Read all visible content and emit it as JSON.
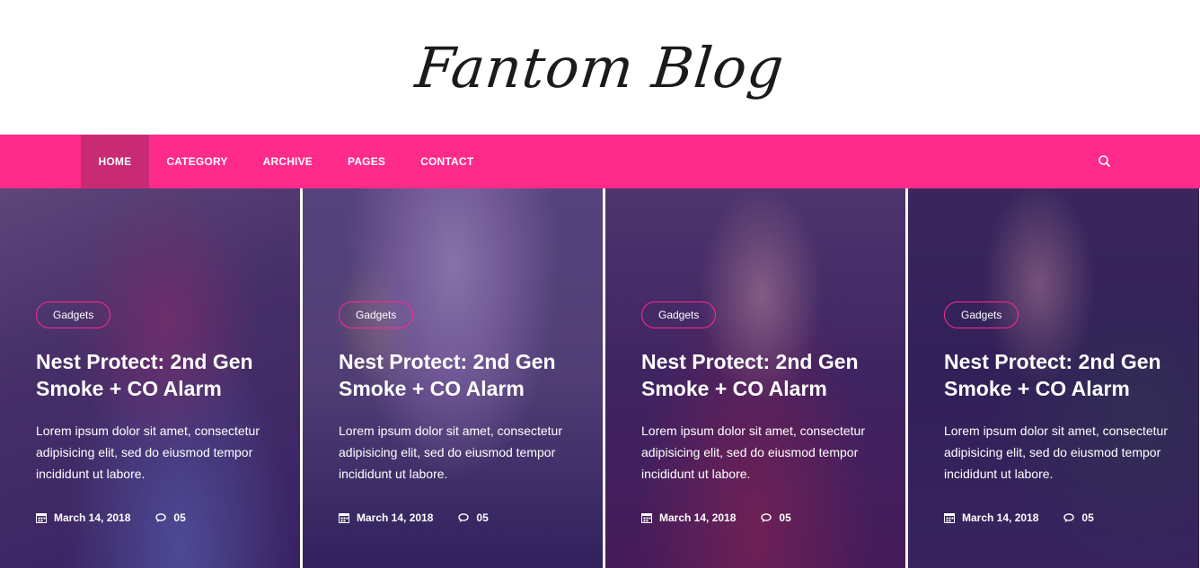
{
  "site": {
    "logo_text": "Fantom Blog"
  },
  "nav": {
    "items": [
      {
        "label": "HOME",
        "active": true
      },
      {
        "label": "CATEGORY",
        "active": false
      },
      {
        "label": "ARCHIVE",
        "active": false
      },
      {
        "label": "PAGES",
        "active": false
      },
      {
        "label": "CONTACT",
        "active": false
      }
    ],
    "search_icon": "search-icon"
  },
  "posts": [
    {
      "tag": "Gadgets",
      "title": "Nest Protect: 2nd Gen Smoke + CO Alarm",
      "excerpt": "Lorem ipsum dolor sit amet, consectetur adipisicing elit, sed do eiusmod tempor incididunt ut labore.",
      "date": "March 14, 2018",
      "comments": "05"
    },
    {
      "tag": "Gadgets",
      "title": "Nest Protect: 2nd Gen Smoke + CO Alarm",
      "excerpt": "Lorem ipsum dolor sit amet, consectetur adipisicing elit, sed do eiusmod tempor incididunt ut labore.",
      "date": "March 14, 2018",
      "comments": "05"
    },
    {
      "tag": "Gadgets",
      "title": "Nest Protect: 2nd Gen Smoke + CO Alarm",
      "excerpt": "Lorem ipsum dolor sit amet, consectetur adipisicing elit, sed do eiusmod tempor incididunt ut labore.",
      "date": "March 14, 2018",
      "comments": "05"
    },
    {
      "tag": "Gadgets",
      "title": "Nest Protect: 2nd Gen Smoke + CO Alarm",
      "excerpt": "Lorem ipsum dolor sit amet, consectetur adipisicing elit, sed do eiusmod tempor incididunt ut labore.",
      "date": "March 14, 2018",
      "comments": "05"
    }
  ],
  "colors": {
    "accent": "#ff2b8b",
    "nav_active": "#c82a74",
    "overlay": "#36186e"
  }
}
